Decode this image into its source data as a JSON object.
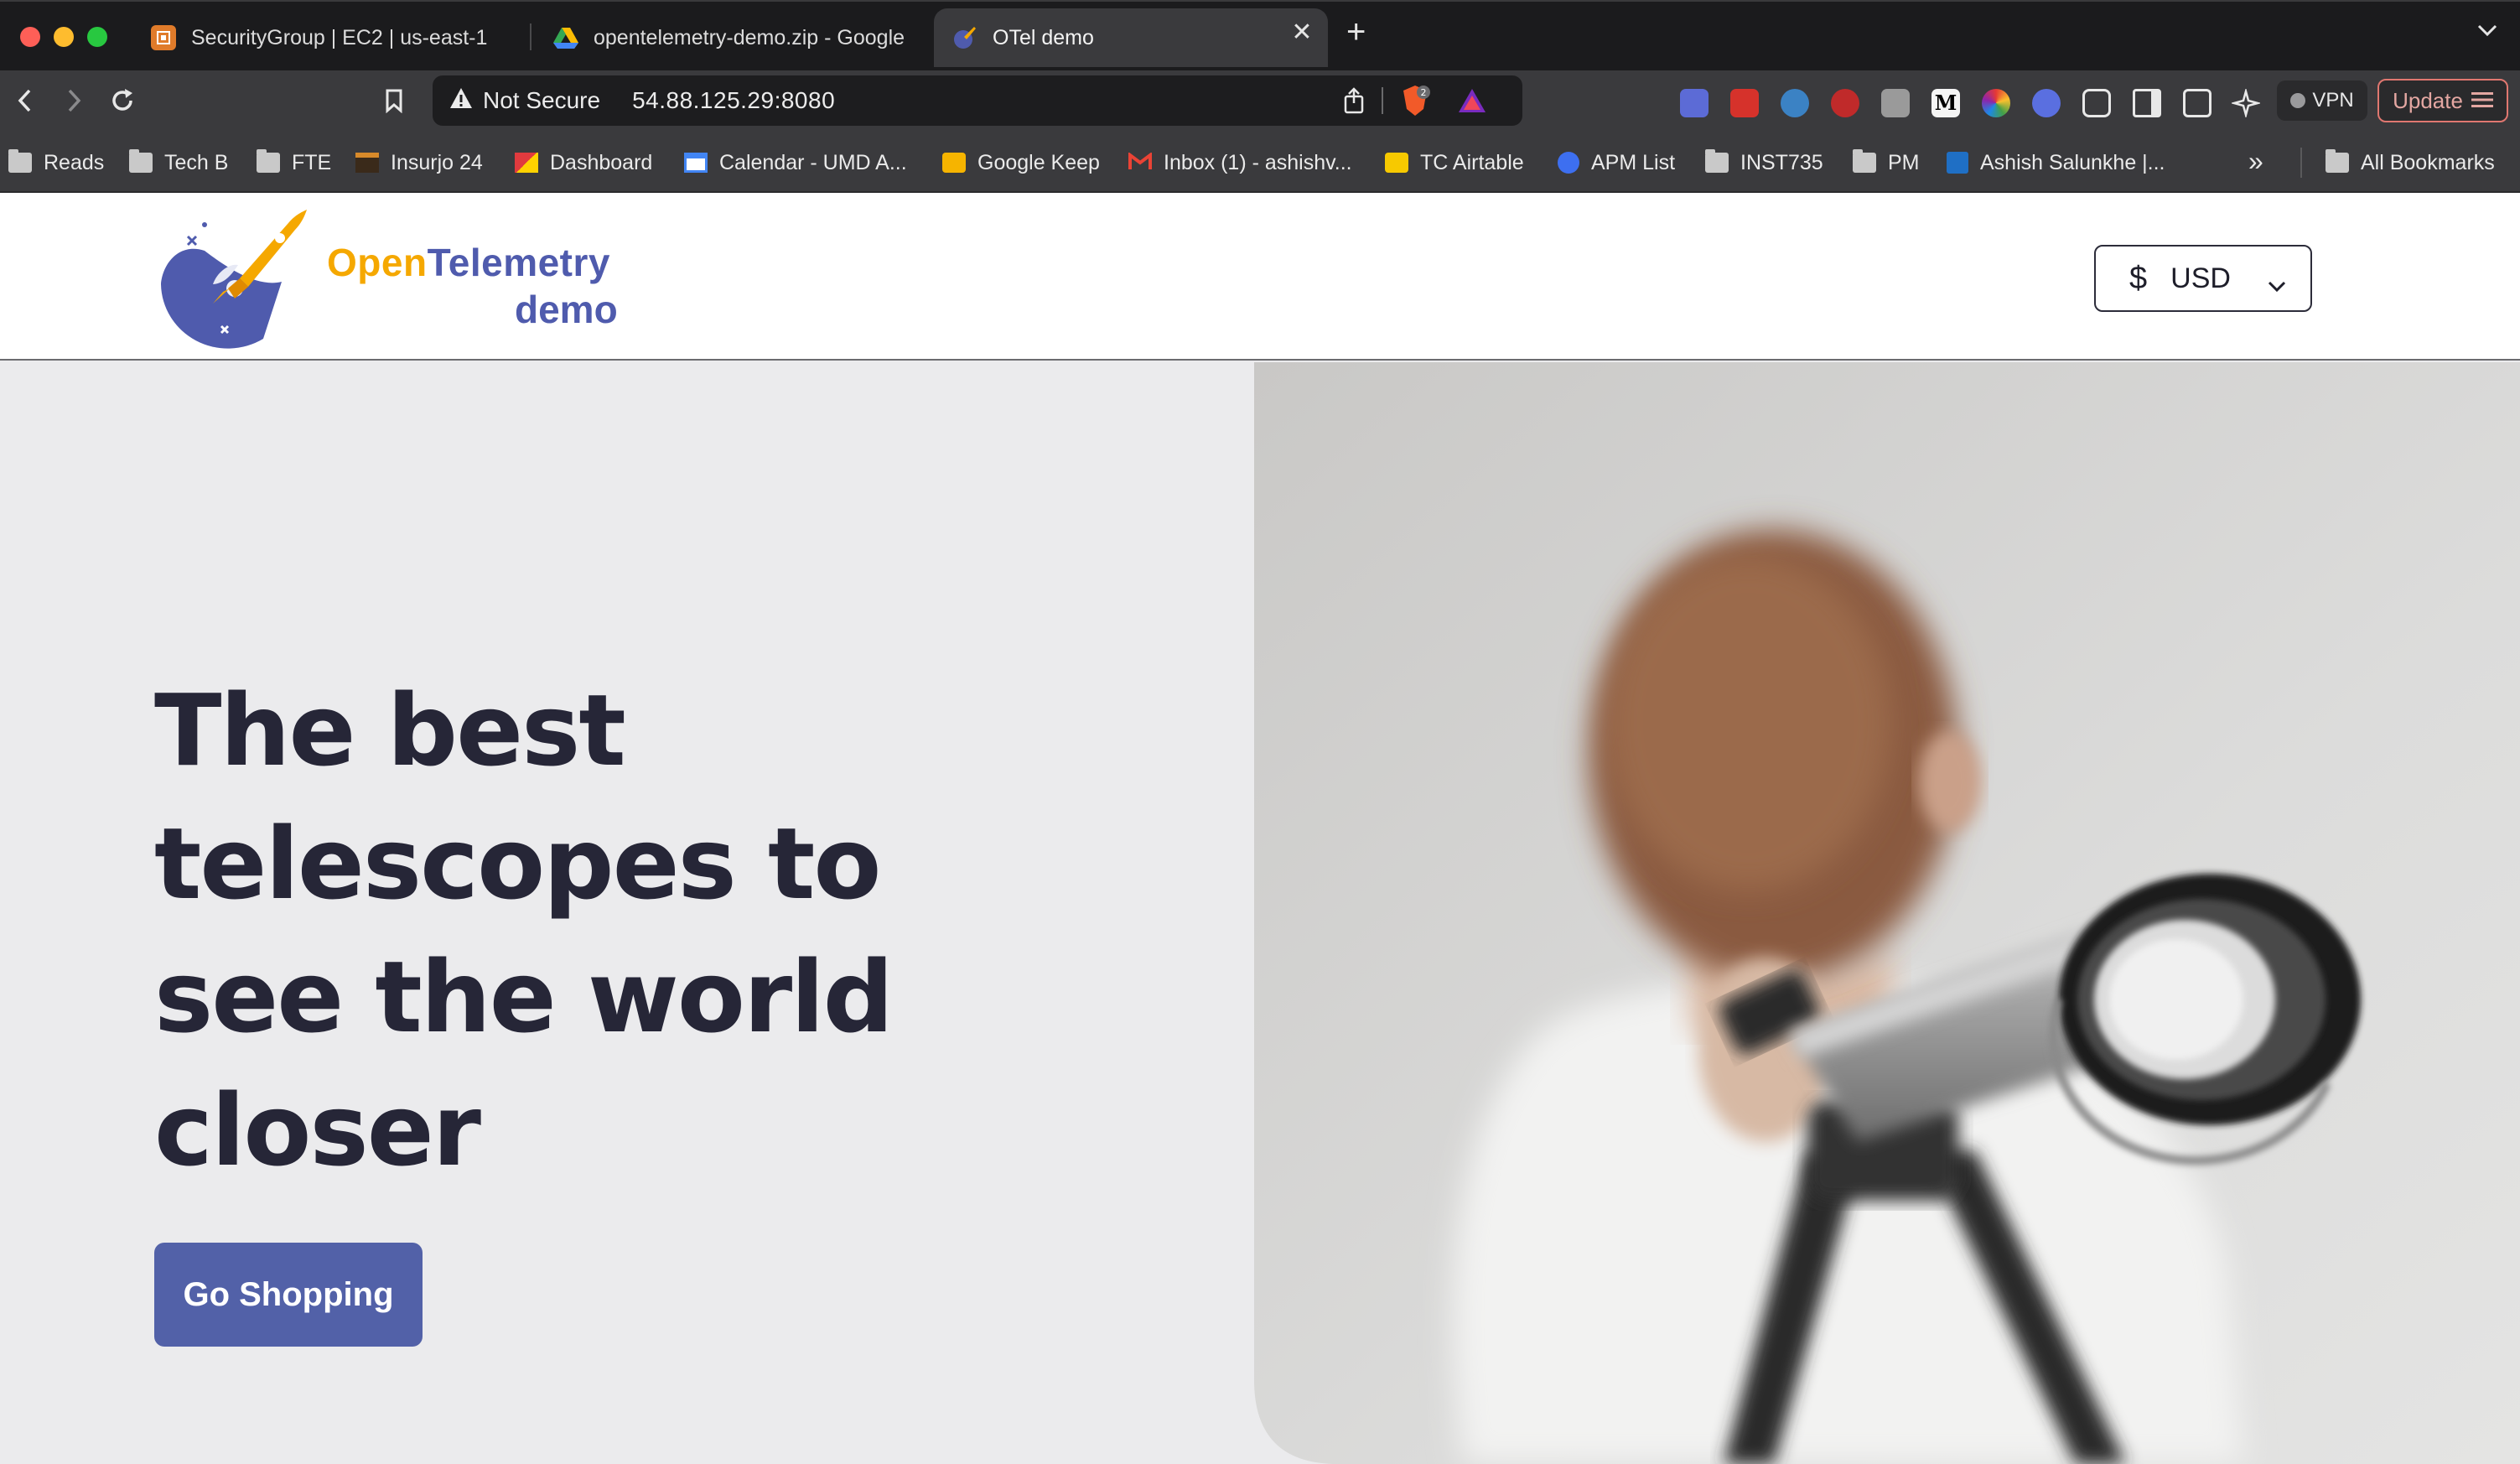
{
  "browser": {
    "tabs": [
      {
        "title": "SecurityGroup | EC2 | us-east-1",
        "icon": "aws-ec2-icon"
      },
      {
        "title": "opentelemetry-demo.zip - Google",
        "icon": "google-drive-icon"
      },
      {
        "title": "OTel demo",
        "icon": "otel-favicon",
        "active": true
      }
    ],
    "address_bar": {
      "security_label": "Not Secure",
      "url": "54.88.125.29:8080"
    },
    "vpn_label": "VPN",
    "update_label": "Update",
    "bookmarks": [
      {
        "label": "Reads",
        "icon": "folder-icon"
      },
      {
        "label": "Tech B",
        "icon": "folder-icon"
      },
      {
        "label": "FTE",
        "icon": "folder-icon"
      },
      {
        "label": "Insurjo 24",
        "icon": "insurjo-icon"
      },
      {
        "label": "Dashboard",
        "icon": "umd-icon"
      },
      {
        "label": "Calendar - UMD A...",
        "icon": "calendar-icon"
      },
      {
        "label": "Google Keep",
        "icon": "keep-icon"
      },
      {
        "label": "Inbox (1) - ashishv...",
        "icon": "gmail-icon"
      },
      {
        "label": "TC Airtable",
        "icon": "airtable-icon"
      },
      {
        "label": "APM List",
        "icon": "list-icon"
      },
      {
        "label": "INST735",
        "icon": "folder-icon"
      },
      {
        "label": "PM",
        "icon": "folder-icon"
      },
      {
        "label": "Ashish Salunkhe |...",
        "icon": "linkedin-icon"
      }
    ],
    "all_bookmarks_label": "All Bookmarks",
    "colors": {
      "chrome_dark": "#1b1b1d",
      "chrome_toolbar": "#3a3a3d"
    }
  },
  "site": {
    "logo": {
      "word1": "Open",
      "word2": "Telemetry",
      "word3": "demo"
    },
    "currency": {
      "symbol": "$",
      "value": "USD"
    },
    "hero": {
      "headline_lines": [
        "The best",
        "telescopes to",
        "see the world",
        "closer"
      ],
      "cta_label": "Go Shopping"
    },
    "colors": {
      "brand_blue": "#4f5bad",
      "brand_orange": "#f5a800",
      "button": "#5261a8",
      "headline": "#262637"
    }
  }
}
